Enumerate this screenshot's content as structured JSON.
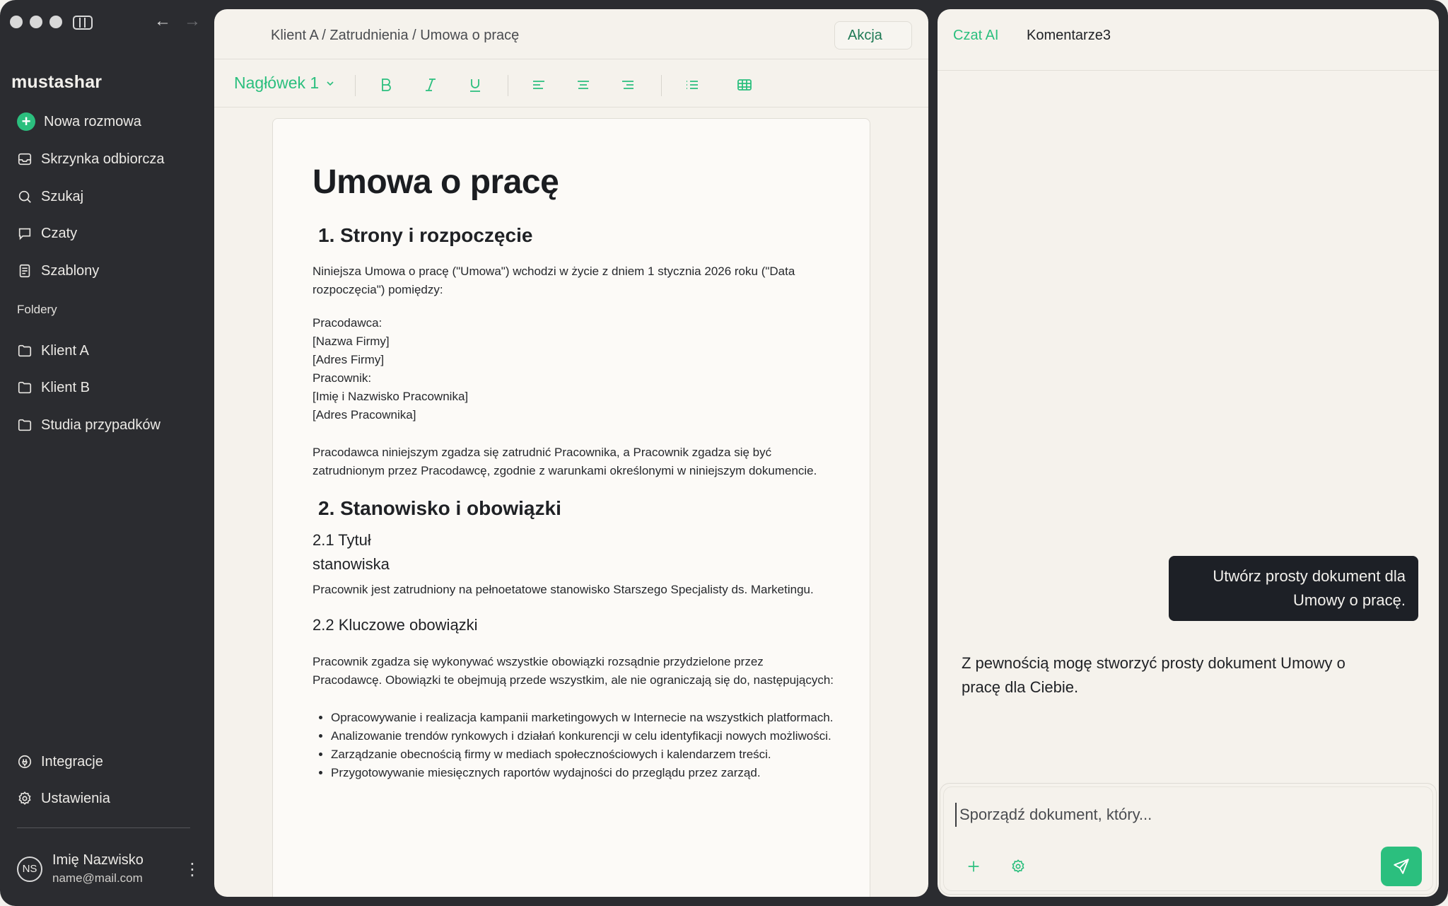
{
  "app": {
    "brand": "mustashar"
  },
  "sidebar": {
    "new_chat": "Nowa rozmowa",
    "items": [
      {
        "label": "Skrzynka odbiorcza",
        "icon": "inbox-icon"
      },
      {
        "label": "Szukaj",
        "icon": "search-icon"
      },
      {
        "label": "Czaty",
        "icon": "chat-icon"
      },
      {
        "label": "Szablony",
        "icon": "template-icon"
      }
    ],
    "folders_label": "Foldery",
    "folders": [
      {
        "label": "Klient A",
        "icon": "folder-icon"
      },
      {
        "label": "Klient B",
        "icon": "folder-icon"
      },
      {
        "label": "Studia przypadków",
        "icon": "folder-icon"
      }
    ],
    "bottom": [
      {
        "label": "Integracje",
        "icon": "integrations-icon"
      },
      {
        "label": "Ustawienia",
        "icon": "settings-icon"
      }
    ],
    "user": {
      "initials": "NS",
      "name": "Imię Nazwisko",
      "email": "name@mail.com"
    }
  },
  "editor": {
    "breadcrumb": "Klient A / Zatrudnienia / Umowa o pracę",
    "action_label": "Akcja",
    "heading_select": "Nagłówek 1",
    "colors": {
      "accent": "#2bbf7e",
      "sidebar_bg": "#2b2c30",
      "panel_bg": "#f5f2ec"
    }
  },
  "document": {
    "title": "Umowa o pracę",
    "s1_heading": "1. Strony i rozpoczęcie",
    "s1_p1": "Niniejsza Umowa o pracę (\"Umowa\") wchodzi w życie z dniem 1 stycznia 2026 roku (\"Data rozpoczęcia\") pomiędzy:",
    "parties": [
      "Pracodawca:",
      "[Nazwa Firmy]",
      "[Adres Firmy]",
      "Pracownik:",
      "[Imię i Nazwisko Pracownika]",
      "[Adres Pracownika]"
    ],
    "s1_p2": "Pracodawca niniejszym zgadza się zatrudnić Pracownika, a Pracownik zgadza się być zatrudnionym przez Pracodawcę, zgodnie z warunkami określonymi w niniejszym dokumencie.",
    "s2_heading": "2. Stanowisko i obowiązki",
    "s21_heading_line1": "2.1 Tytuł",
    "s21_heading_line2": "stanowiska",
    "s21_p": "Pracownik jest zatrudniony na pełnoetatowe stanowisko Starszego Specjalisty ds. Marketingu.",
    "s22_heading": "2.2 Kluczowe obowiązki",
    "s22_p": "Pracownik zgadza się wykonywać wszystkie obowiązki rozsądnie przydzielone przez Pracodawcę. Obowiązki te obejmują przede wszystkim, ale nie ograniczają się do, następujących:",
    "duties": [
      "Opracowywanie i realizacja kampanii marketingowych w Internecie na wszystkich platformach.",
      "Analizowanie trendów rynkowych i działań konkurencji w celu identyfikacji nowych możliwości.",
      "Zarządzanie obecnością firmy w mediach społecznościowych i kalendarzem treści.",
      "Przygotowywanie miesięcznych raportów wydajności do przeglądu przez zarząd."
    ]
  },
  "chat": {
    "tabs": {
      "ai": "Czat AI",
      "comments": "Komentarze",
      "comments_count": "3"
    },
    "user_message": "Utwórz prosty dokument dla Umowy o pracę.",
    "ai_message": "Z pewnością mogę stworzyć prosty dokument Umowy o pracę dla Ciebie.",
    "input_placeholder": "Sporządź dokument, który..."
  }
}
